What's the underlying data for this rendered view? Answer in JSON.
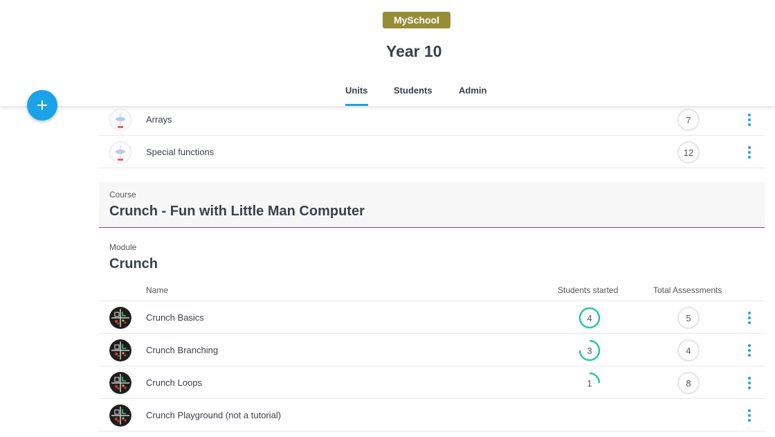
{
  "header": {
    "school_badge": "MySchool",
    "title": "Year 10"
  },
  "tabs": [
    {
      "label": "Units",
      "active": true
    },
    {
      "label": "Students",
      "active": false
    },
    {
      "label": "Admin",
      "active": false
    }
  ],
  "fab": {
    "icon": "plus-icon"
  },
  "top_units": [
    {
      "name": "Arrays",
      "total": "7",
      "icon": "unit-thumbnail-icon"
    },
    {
      "name": "Special functions",
      "total": "12",
      "icon": "unit-thumbnail-icon"
    }
  ],
  "course": {
    "label": "Course",
    "title": "Crunch - Fun with Little Man Computer"
  },
  "module": {
    "label": "Module",
    "title": "Crunch"
  },
  "table": {
    "col_name": "Name",
    "col_started": "Students started",
    "col_total": "Total Assessments",
    "rows": [
      {
        "name": "Crunch Basics",
        "started": "4",
        "started_fraction": 1.0,
        "total": "5"
      },
      {
        "name": "Crunch Branching",
        "started": "3",
        "started_fraction": 0.75,
        "total": "4"
      },
      {
        "name": "Crunch Loops",
        "started": "1",
        "started_fraction": 0.25,
        "total": "8"
      },
      {
        "name": "Crunch Playground (not a tutorial)",
        "started": "",
        "started_fraction": null,
        "total": ""
      }
    ]
  },
  "colors": {
    "accent": "#1aa3e8",
    "badge": "#978d36",
    "progress": "#2ec4a0",
    "course_rule": "#7b4a7a"
  }
}
